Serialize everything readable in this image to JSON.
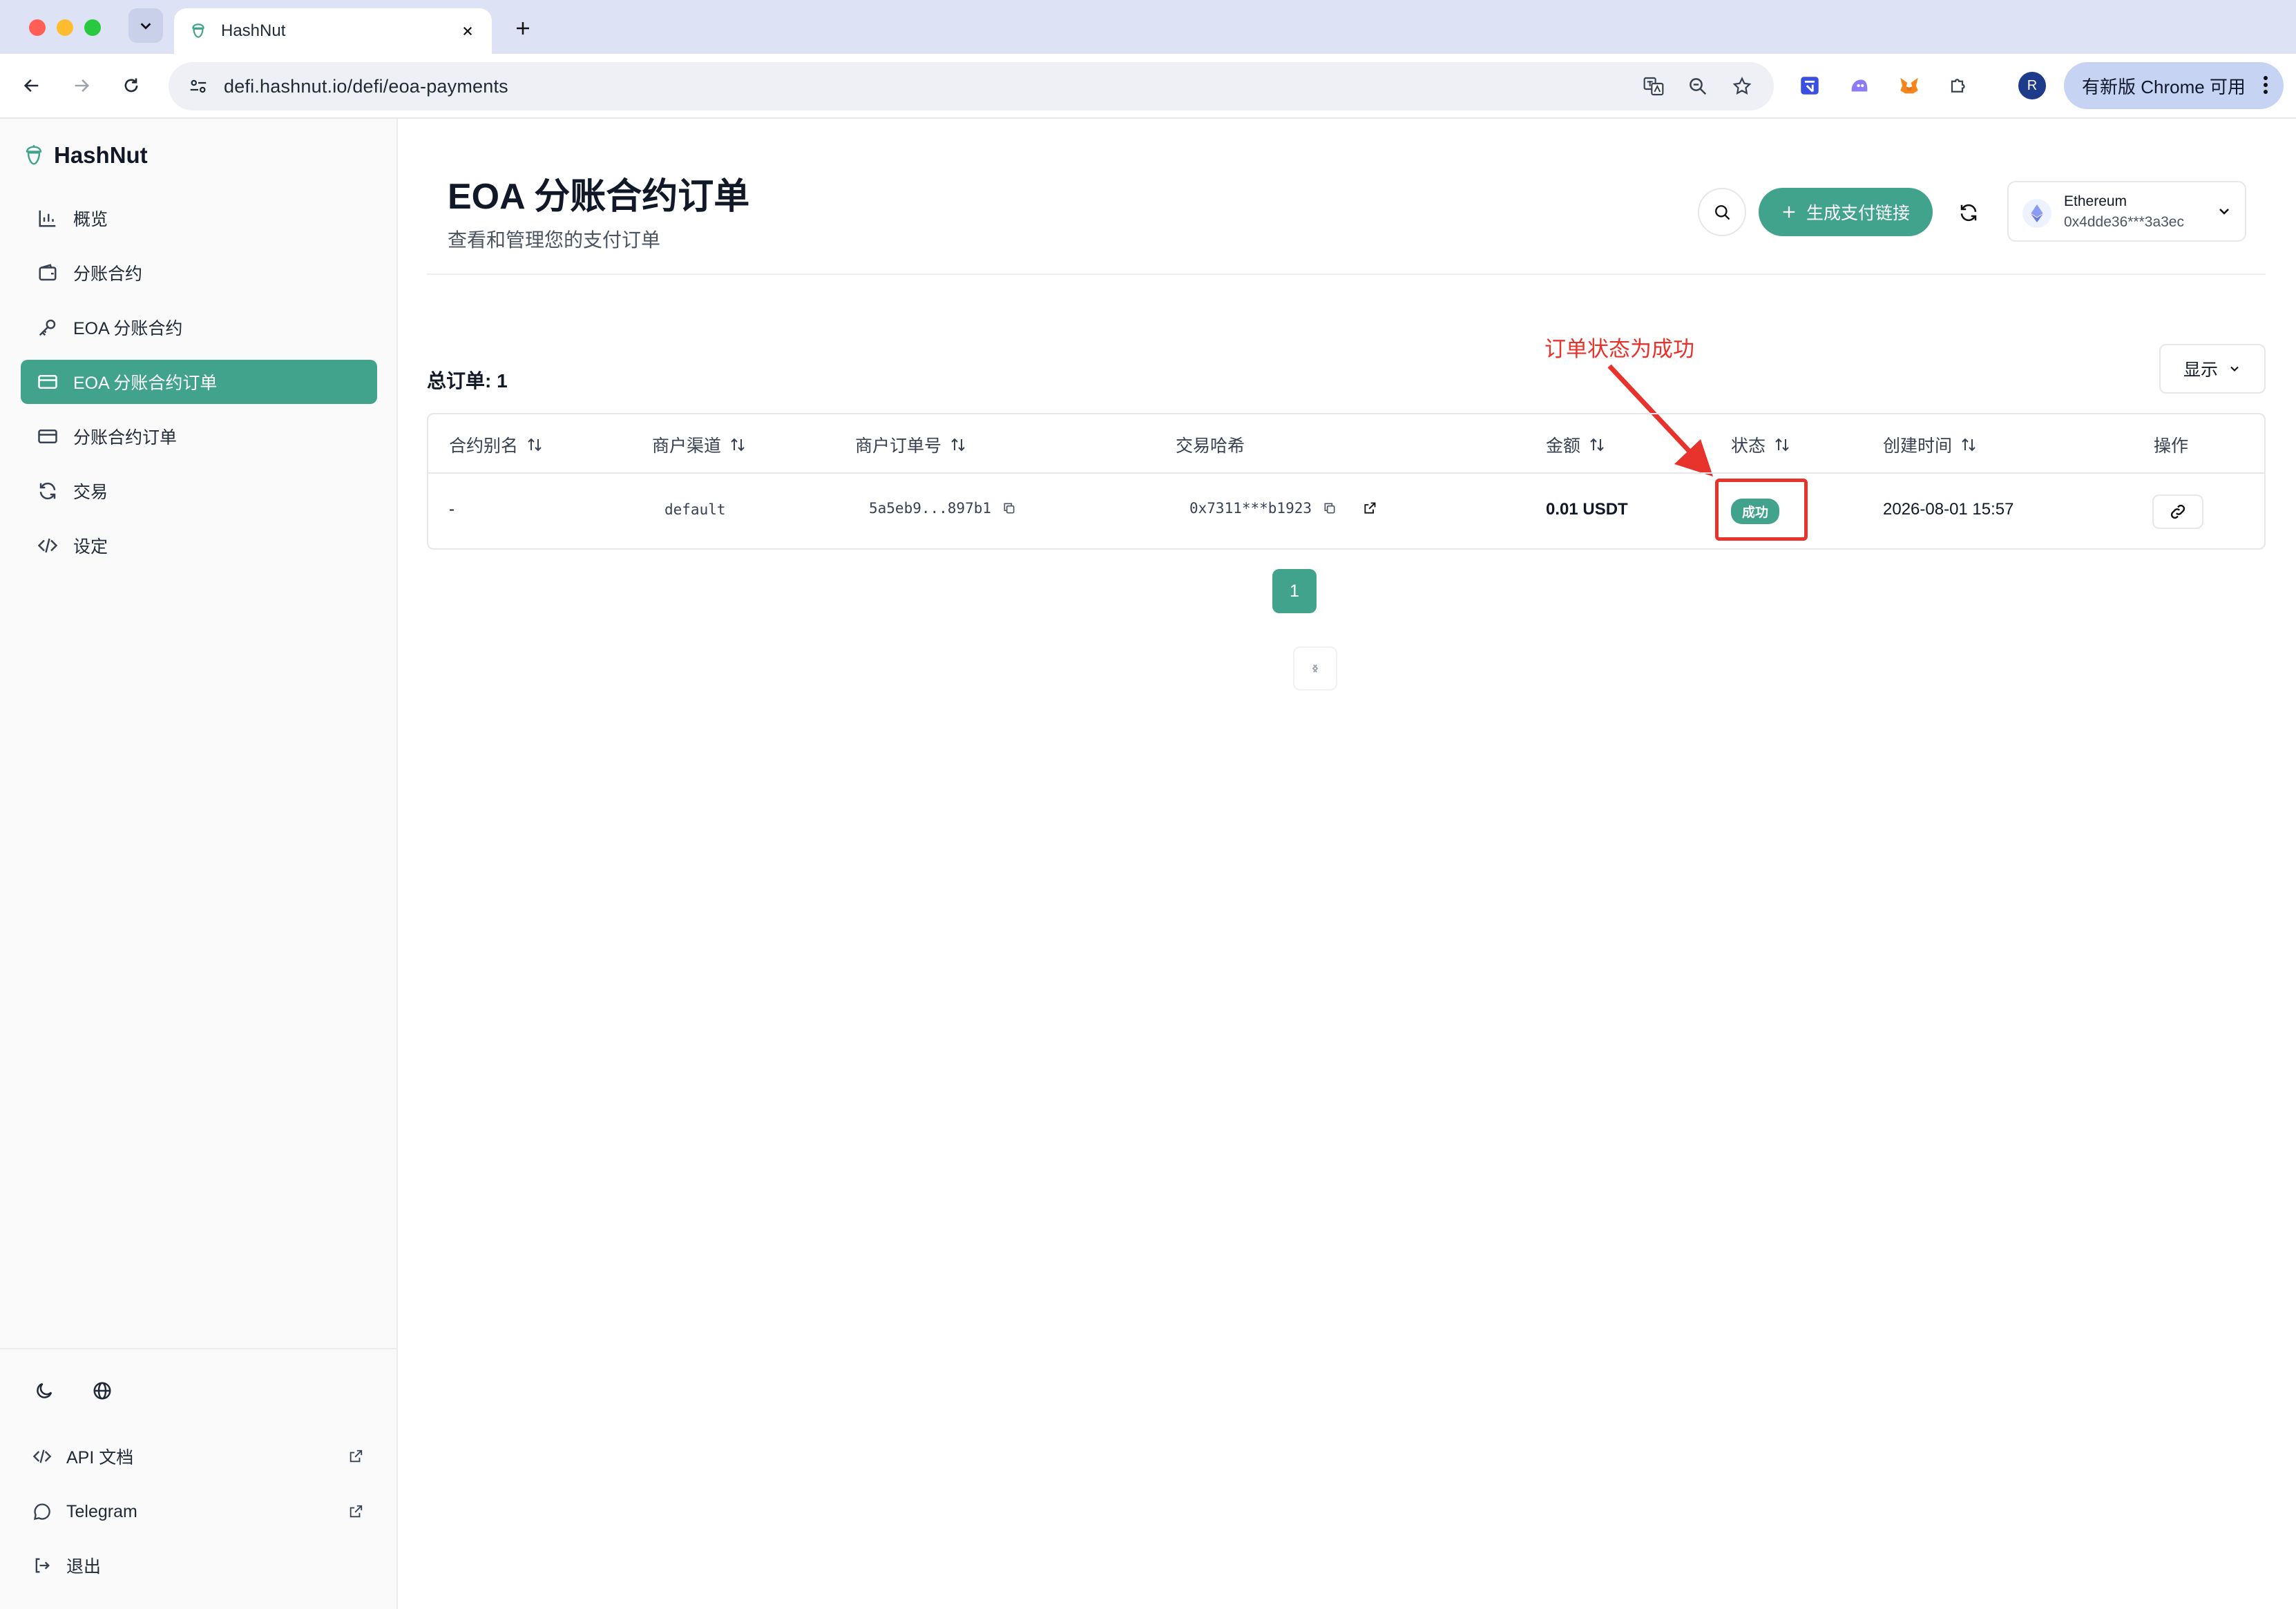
{
  "browser": {
    "tab_title": "HashNut",
    "url": "defi.hashnut.io/defi/eoa-payments",
    "profile_initial": "R",
    "update_label": "有新版 Chrome 可用"
  },
  "sidebar": {
    "brand": "HashNut",
    "items": [
      {
        "label": "概览",
        "icon": "chart-icon"
      },
      {
        "label": "分账合约",
        "icon": "wallet-icon"
      },
      {
        "label": "EOA 分账合约",
        "icon": "key-icon"
      },
      {
        "label": "EOA 分账合约订单",
        "icon": "card-icon",
        "active": true
      },
      {
        "label": "分账合约订单",
        "icon": "card-icon"
      },
      {
        "label": "交易",
        "icon": "refresh-icon"
      },
      {
        "label": "设定",
        "icon": "code-icon"
      }
    ],
    "links": [
      {
        "label": "API 文档",
        "icon": "code-icon"
      },
      {
        "label": "Telegram",
        "icon": "message-icon"
      },
      {
        "label": "退出",
        "icon": "logout-icon"
      }
    ]
  },
  "header": {
    "title": "EOA 分账合约订单",
    "subtitle": "查看和管理您的支付订单",
    "generate_label": "生成支付链接",
    "wallet_network": "Ethereum",
    "wallet_address": "0x4dde36***3a3ec"
  },
  "annotation": "订单状态为成功",
  "summary": {
    "total_label": "总订单: 1",
    "display_label": "显示"
  },
  "table": {
    "headers": {
      "alias": "合约别名",
      "channel": "商户渠道",
      "order_no": "商户订单号",
      "tx_hash": "交易哈希",
      "amount": "金额",
      "status": "状态",
      "created": "创建时间",
      "actions": "操作"
    },
    "rows": [
      {
        "alias": "-",
        "channel": "default",
        "order_no": "5a5eb9...897b1",
        "tx_hash": "0x7311***b1923",
        "amount": "0.01 USDT",
        "status": "成功",
        "created": "2026-08-01 15:57"
      }
    ]
  },
  "pagination": {
    "current": "1"
  },
  "colors": {
    "accent": "#41a38c",
    "annotation": "#e8322c"
  }
}
